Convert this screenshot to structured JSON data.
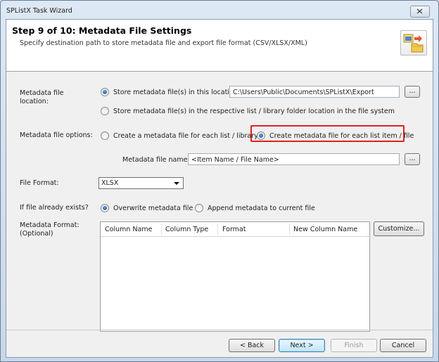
{
  "window": {
    "title": "SPListX Task Wizard"
  },
  "header": {
    "step_title": "Step 9 of 10: Metadata File Settings",
    "subtitle": "Specify destination path to store metadata file and export file format (CSV/XLSX/XML)"
  },
  "location": {
    "label": "Metadata file location:",
    "option_this": "Store metadata file(s) in this location",
    "path": "C:\\Users\\Public\\Documents\\SPListX\\Export",
    "browse": "...",
    "option_respective": "Store metadata file(s) in the respective list / library folder location in the file system"
  },
  "options": {
    "label": "Metadata file options:",
    "per_list": "Create a metadata file for each list / library",
    "per_item": "Create metadata file for each list item / file"
  },
  "filename": {
    "label": "Metadata file name:",
    "value": "<Item Name / File Name>",
    "browse": "..."
  },
  "format": {
    "label": "File Format:",
    "selected": "XLSX"
  },
  "exists": {
    "label": "If file already exists?",
    "overwrite": "Overwrite metadata file",
    "append": "Append metadata to current file"
  },
  "metadata_format": {
    "label": "Metadata Format:",
    "sublabel": "(Optional)",
    "columns": [
      "Column Name",
      "Column Type",
      "Format",
      "New Column Name"
    ],
    "customize": "Customize..."
  },
  "footer": {
    "back": "< Back",
    "next": "Next >",
    "finish": "Finish",
    "cancel": "Cancel"
  }
}
